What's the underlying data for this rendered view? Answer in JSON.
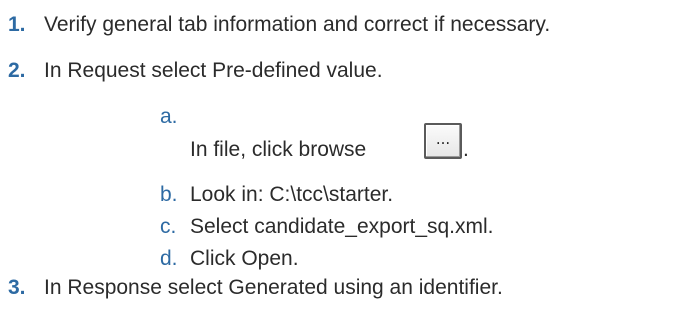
{
  "steps": [
    {
      "num": "1.",
      "text": "Verify general tab information and correct if necessary."
    },
    {
      "num": "2.",
      "text": "In Request select Pre-defined value."
    },
    {
      "num": "3.",
      "text": "In Response select Generated using an identifier."
    }
  ],
  "substeps": [
    {
      "letter": "a.",
      "text": "In file, click browse",
      "button_label": "...",
      "suffix": "."
    },
    {
      "letter": "b.",
      "text": "Look in: C:\\tcc\\starter."
    },
    {
      "letter": "c.",
      "text": "Select candidate_export_sq.xml."
    },
    {
      "letter": "d.",
      "text": "Click Open."
    }
  ],
  "colors": {
    "accent": "#2d6aa3",
    "text": "#2b2b2b"
  }
}
